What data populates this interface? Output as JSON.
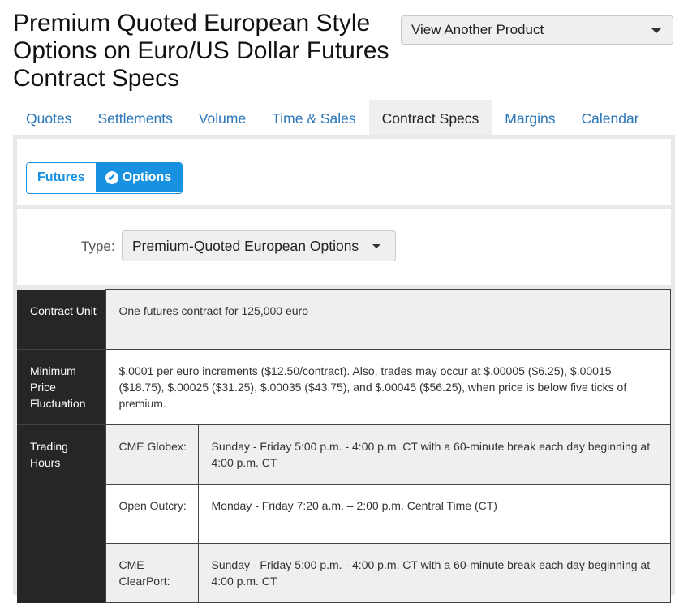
{
  "page": {
    "title": "Premium Quoted European Style Options on Euro/US Dollar Futures Contract Specs",
    "product_dropdown": "View Another Product"
  },
  "tabs": [
    {
      "label": "Quotes"
    },
    {
      "label": "Settlements"
    },
    {
      "label": "Volume"
    },
    {
      "label": "Time & Sales"
    },
    {
      "label": "Contract Specs",
      "active": true
    },
    {
      "label": "Margins"
    },
    {
      "label": "Calendar"
    }
  ],
  "toggle": {
    "futures": "Futures",
    "options": "Options",
    "selected": "Options"
  },
  "type_filter": {
    "label": "Type:",
    "value": "Premium-Quoted European Options"
  },
  "specs": {
    "contract_unit": {
      "label": "Contract Unit",
      "value": "One futures contract for 125,000 euro"
    },
    "min_price_fluctuation": {
      "label": "Minimum Price Fluctuation",
      "value": "$.0001 per euro increments ($12.50/contract). Also, trades may occur at $.00005 ($6.25), $.00015 ($18.75), $.00025 ($31.25), $.00035 ($43.75), and $.00045 ($56.25), when price is below five ticks of premium."
    },
    "trading_hours": {
      "label": "Trading Hours",
      "rows": [
        {
          "venue": "CME Globex:",
          "hours": "Sunday - Friday 5:00 p.m. - 4:00 p.m. CT with a 60-minute break each day beginning at 4:00 p.m. CT"
        },
        {
          "venue": "Open Outcry:",
          "hours": "Monday - Friday 7:20 a.m. – 2:00 p.m. Central Time (CT)"
        },
        {
          "venue": "CME ClearPort:",
          "hours": "Sunday - Friday 5:00 p.m. - 4:00 p.m. CT with a 60-minute break each day beginning at 4:00 p.m. CT"
        }
      ]
    }
  },
  "colors": {
    "accent": "#1791e0",
    "link": "#2a76b8",
    "header_cell": "#262626",
    "panel_bg": "#e9e9e9"
  }
}
